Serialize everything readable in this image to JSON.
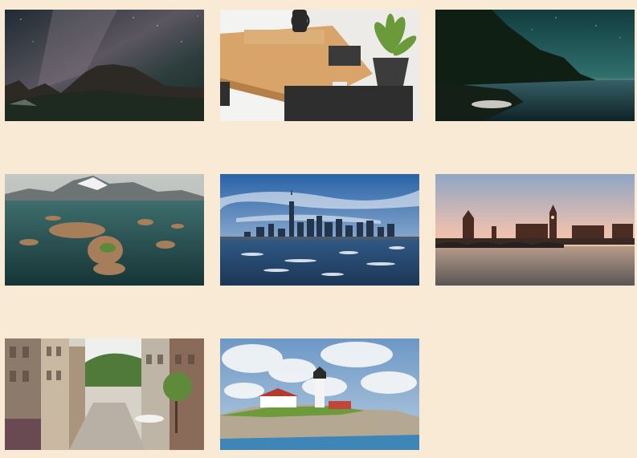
{
  "gallery": {
    "background": "#f9ead6",
    "items": [
      {
        "icon": "milky-way-mountain-image"
      },
      {
        "icon": "desk-workspace-image"
      },
      {
        "icon": "night-lake-forest-image"
      },
      {
        "icon": "coastal-islands-mountains-image"
      },
      {
        "icon": "city-skyline-water-image"
      },
      {
        "icon": "london-bridge-sunset-image"
      },
      {
        "icon": "old-town-street-image"
      },
      {
        "icon": "lighthouse-coast-image"
      }
    ]
  }
}
